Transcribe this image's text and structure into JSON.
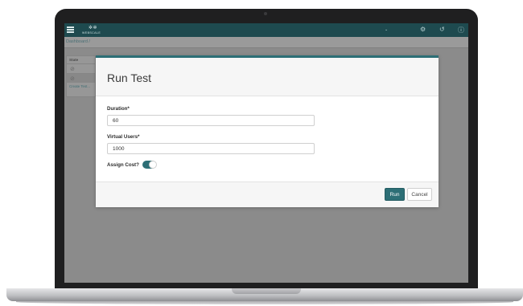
{
  "app": {
    "logo_text": "WEBSCALE",
    "breadcrumb": "Dashboard /"
  },
  "side_panel": {
    "header": "State",
    "link": "Create Test..."
  },
  "modal": {
    "title": "Run Test",
    "duration_label": "Duration*",
    "duration_value": "60",
    "virtual_users_label": "Virtual Users*",
    "virtual_users_value": "1000",
    "assign_cost_label": "Assign Cost?",
    "assign_cost_on": true,
    "run_label": "Run",
    "cancel_label": "Cancel"
  },
  "icons": {
    "menu": "hamburger-menu-icon",
    "settings": "gear-icon",
    "history": "history-icon",
    "help": "help-icon",
    "status": "check-circle-icon"
  },
  "colors": {
    "header": "#1e4a4f",
    "accent": "#2d6f76",
    "overlay": "#8b8b8b"
  }
}
